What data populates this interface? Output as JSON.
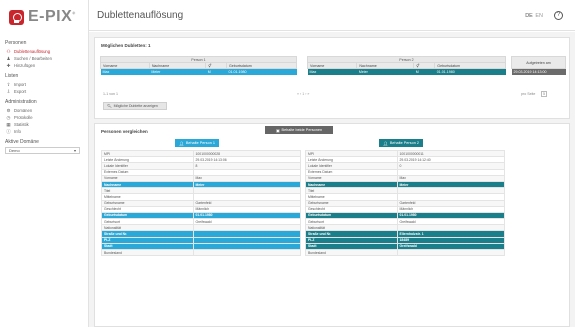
{
  "app": {
    "logo_text": "E-PIX",
    "logo_sup": "®"
  },
  "sidebar": {
    "sections": [
      {
        "title": "Personen",
        "items": [
          {
            "label": "Dublettenauflösung",
            "icon": "group-icon",
            "active": true
          },
          {
            "label": "Suchen / Bearbeiten",
            "icon": "users-icon",
            "active": false
          },
          {
            "label": "Hinzufügen",
            "icon": "user-add-icon",
            "active": false
          }
        ]
      },
      {
        "title": "Listen",
        "items": [
          {
            "label": "Import",
            "icon": "upload-icon",
            "active": false
          },
          {
            "label": "Export",
            "icon": "download-icon",
            "active": false
          }
        ]
      },
      {
        "title": "Administration",
        "items": [
          {
            "label": "Domänen",
            "icon": "gear-icon",
            "active": false
          },
          {
            "label": "Protokolle",
            "icon": "clock-icon",
            "active": false
          },
          {
            "label": "Statistik",
            "icon": "chart-icon",
            "active": false
          },
          {
            "label": "Info",
            "icon": "info-icon",
            "active": false
          }
        ]
      }
    ],
    "domain_section": "Aktive Domäne",
    "domain_value": "Demo"
  },
  "header": {
    "title": "Dublettenauflösung",
    "lang_de": "DE",
    "lang_en": "EN",
    "help": "?"
  },
  "duplicates": {
    "title": "Möglichen Dubletten: 1",
    "person1": "Person 1",
    "person2": "Person 2",
    "columns": [
      "Vorname",
      "Nachname",
      "⚥",
      "Geburtsdatum"
    ],
    "p1_row": [
      "Max",
      "Meier",
      "M",
      "01.01.1980"
    ],
    "p2_row": [
      "Max",
      "Meier",
      "M",
      "01.01.1980"
    ],
    "found_header": "Aufgetreten am",
    "found_value": "29.03.2019 14:13:00",
    "count": "1-1 von 1",
    "pager": "«  ‹  1  ›  »",
    "per_page_label": "pro Seite",
    "per_page": "5",
    "show_button": "Mögliche Dublette anzeigen"
  },
  "compare": {
    "title": "Personen vergleichen",
    "keep_both": "Behalte beide Personen",
    "keep_p1": "Behalte Person 1",
    "keep_p2": "Behalte Person 2",
    "p1": [
      [
        "MPI",
        "1001000000028"
      ],
      [
        "Letzte Änderung",
        "29.03.2019 14:13:06"
      ],
      [
        "Lokale Identifier",
        "8"
      ],
      [
        "Externes Datum",
        ""
      ],
      [
        "Vorname",
        "Max"
      ],
      [
        "Nachname",
        "Meier"
      ],
      [
        "Titel",
        ""
      ],
      [
        "Mittelname",
        ""
      ],
      [
        "Geburtsname",
        "Gartenfeld"
      ],
      [
        "Geschlecht",
        "Männlich"
      ],
      [
        "Geburtsdatum",
        "01.01.1980"
      ],
      [
        "Geburtsort",
        "Greifswald"
      ],
      [
        "Nationalität",
        ""
      ],
      [
        "Straße und Nr.",
        ""
      ],
      [
        "PLZ",
        ""
      ],
      [
        "Stadt",
        ""
      ],
      [
        "Bundesland",
        ""
      ]
    ],
    "p2": [
      [
        "MPI",
        "1001000000011"
      ],
      [
        "Letzte Änderung",
        "29.03.2019 14:12:40"
      ],
      [
        "Lokale Identifier",
        "0"
      ],
      [
        "Externes Datum",
        ""
      ],
      [
        "Vorname",
        "Max"
      ],
      [
        "Nachname",
        "Meier"
      ],
      [
        "Titel",
        ""
      ],
      [
        "Mittelname",
        ""
      ],
      [
        "Geburtsname",
        "Gartenfeld"
      ],
      [
        "Geschlecht",
        "Männlich"
      ],
      [
        "Geburtsdatum",
        "01.01.1980"
      ],
      [
        "Geburtsort",
        "Greifswald"
      ],
      [
        "Nationalität",
        ""
      ],
      [
        "Straße und Nr.",
        "Ellernholzstr. 1"
      ],
      [
        "PLZ",
        "18489"
      ],
      [
        "Stadt",
        "Greifswald"
      ],
      [
        "Bundesland",
        ""
      ]
    ],
    "highlight_rows": [
      5,
      10,
      13,
      14,
      15
    ],
    "colors": {
      "p1": "#2aa9d8",
      "p2": "#1a7f8a"
    }
  }
}
